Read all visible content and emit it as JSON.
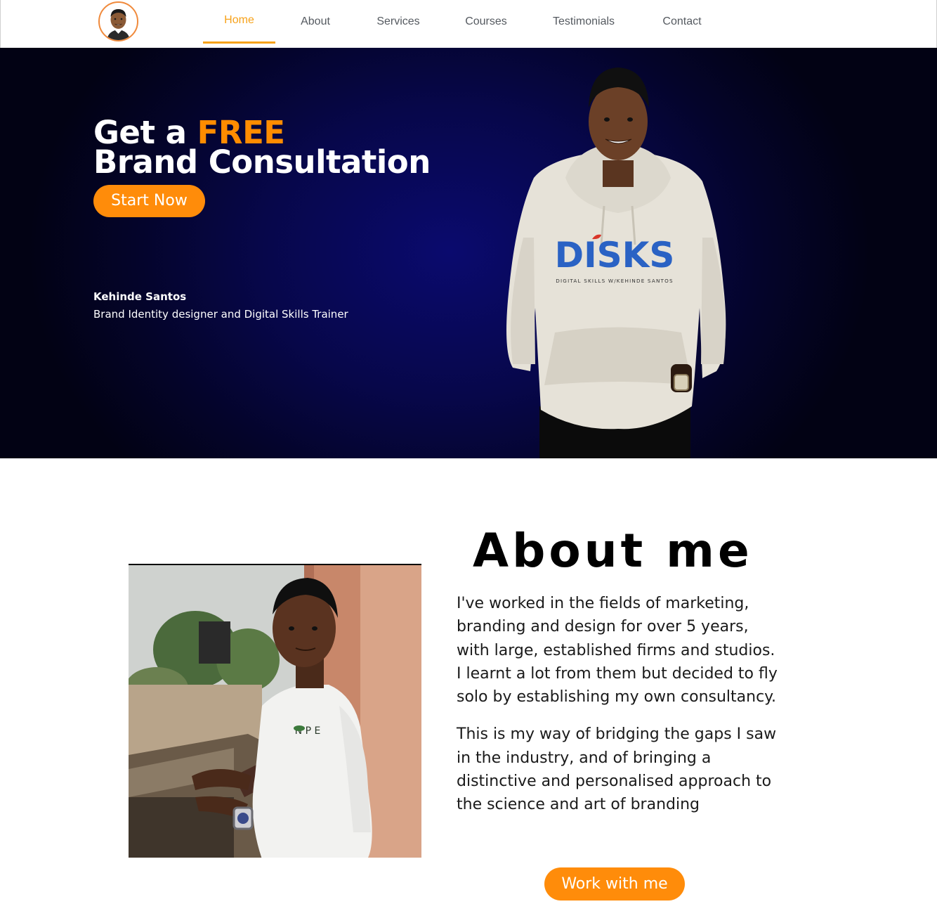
{
  "header": {
    "logo_icon": "profile-avatar-logo",
    "accent_color": "#f7a21a",
    "nav": [
      {
        "label": "Home",
        "active": true
      },
      {
        "label": "About",
        "active": false
      },
      {
        "label": "Services",
        "active": false
      },
      {
        "label": "Courses",
        "active": false
      },
      {
        "label": "Testimonials",
        "active": false
      },
      {
        "label": "Contact",
        "active": false
      }
    ]
  },
  "hero": {
    "title_prefix": "Get a ",
    "title_highlight": "FREE",
    "title_line2": "Brand Consultation",
    "cta_label": "Start Now",
    "name": "Kehinde Santos",
    "role": "Brand Identity designer and Digital Skills Trainer",
    "hoodie_brand": "DISKS",
    "hoodie_tagline": "DIGITAL SKILLS W/KEHINDE SANTOS",
    "cta_color": "#ff8c0a",
    "bg_color": "#07074a"
  },
  "about": {
    "title": "About me",
    "paragraphs": [
      "I've worked in the fields of marketing, branding and design for over 5 years, with large, established firms and studios. I learnt a lot from them but decided to fly solo by establishing my own consultancy.",
      "This is my way of bridging the gaps I saw in the industry, and of bringing a distinctive and personalised approach to the science and art of branding"
    ],
    "cta_label": "Work with me"
  }
}
